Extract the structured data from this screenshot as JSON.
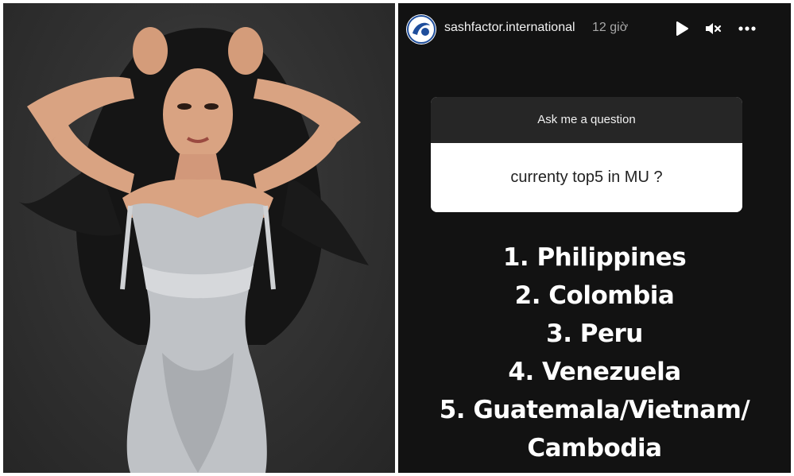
{
  "photo": {
    "description_icon": "portrait-photo"
  },
  "story": {
    "username": "sashfactor.international",
    "timestamp": "12 giờ",
    "icons": {
      "play": "play-icon",
      "mute": "speaker-muted-icon",
      "more": "more-dots-icon"
    },
    "question_card": {
      "header": "Ask me a question",
      "question": "currenty top5 in MU ?"
    },
    "ranking": [
      "1. Philippines",
      "2. Colombia",
      "3. Peru",
      "4. Venezuela",
      "5. Guatemala/Vietnam/",
      "Cambodia"
    ]
  },
  "colors": {
    "story_bg": "#121212",
    "card_header_bg": "#262626",
    "card_body_bg": "#ffffff",
    "photo_bg": "#333333",
    "avatar_accent": "#1f4e9c"
  }
}
